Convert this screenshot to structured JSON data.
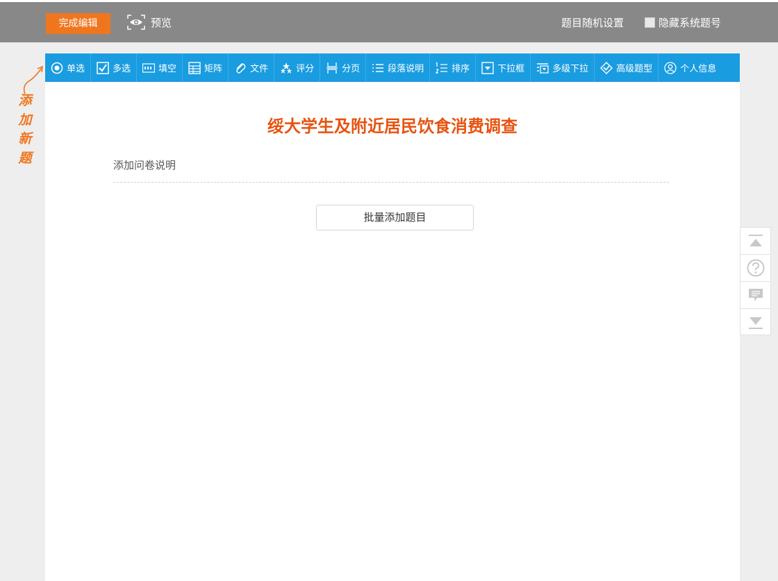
{
  "header": {
    "done_label": "完成编辑",
    "preview_label": "预览",
    "random_label": "题目随机设置",
    "hide_label": "隐藏系统题号"
  },
  "toolbar": {
    "items": [
      {
        "label": "单选",
        "icon": "radio-icon"
      },
      {
        "label": "多选",
        "icon": "checkbox-icon"
      },
      {
        "label": "填空",
        "icon": "text-input-icon"
      },
      {
        "label": "矩阵",
        "icon": "matrix-icon"
      },
      {
        "label": "文件",
        "icon": "paperclip-icon"
      },
      {
        "label": "评分",
        "icon": "stars-icon"
      },
      {
        "label": "分页",
        "icon": "page-break-icon"
      },
      {
        "label": "段落说明",
        "icon": "paragraph-icon"
      },
      {
        "label": "排序",
        "icon": "sort-icon"
      },
      {
        "label": "下拉框",
        "icon": "dropdown-icon"
      },
      {
        "label": "多级下拉",
        "icon": "multi-dropdown-icon"
      },
      {
        "label": "高级题型",
        "icon": "advanced-icon"
      },
      {
        "label": "个人信息",
        "icon": "user-icon"
      }
    ]
  },
  "side": {
    "add_new": "添加新题"
  },
  "survey": {
    "title": "绥大学生及附近居民饮食消费调查",
    "description_placeholder": "添加问卷说明",
    "batch_add_label": "批量添加题目"
  },
  "colors": {
    "accent": "#f0761e",
    "toolbar": "#1a9ce0",
    "title": "#e8520f",
    "header": "#888888"
  }
}
